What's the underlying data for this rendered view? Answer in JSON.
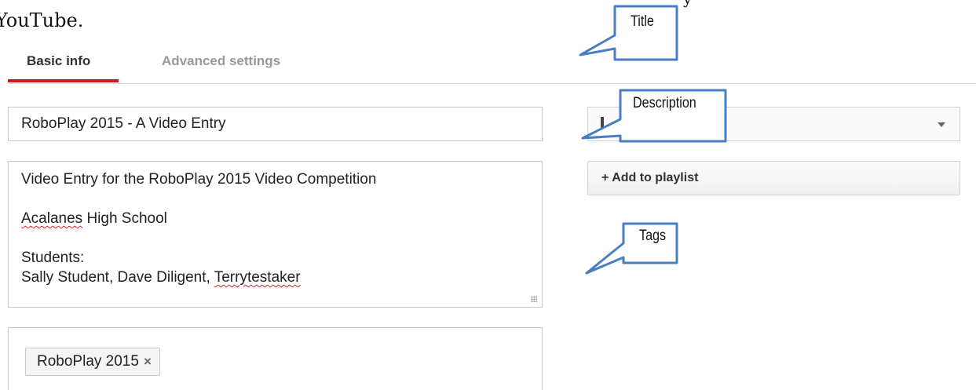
{
  "document": {
    "top_text": "y",
    "leading_text": "YouTube."
  },
  "tabs": [
    {
      "label": "Basic info",
      "active": true
    },
    {
      "label": "Advanced settings",
      "active": false
    }
  ],
  "form": {
    "title_value": "RoboPlay 2015 - A Video Entry",
    "description": {
      "line1": "Video Entry for the RoboPlay 2015 Video Competition",
      "line2_underlined": "Acalanes",
      "line2_rest": " High School",
      "line3": "Students:",
      "line4_prefix": "Sally Student, Dave Diligent, ",
      "line4_underlined": "Terrytestaker"
    },
    "tags": [
      {
        "label": "RoboPlay 2015",
        "remove_glyph": "×"
      }
    ]
  },
  "sidebar": {
    "add_to_playlist_label": "+ Add to playlist"
  },
  "callouts": {
    "title": "Title",
    "description": "Description",
    "tags": "Tags"
  },
  "colors": {
    "active_tab_underline": "#cc181e",
    "callout_border": "#4a7ec2",
    "spellcheck_underline": "#dd2233"
  }
}
